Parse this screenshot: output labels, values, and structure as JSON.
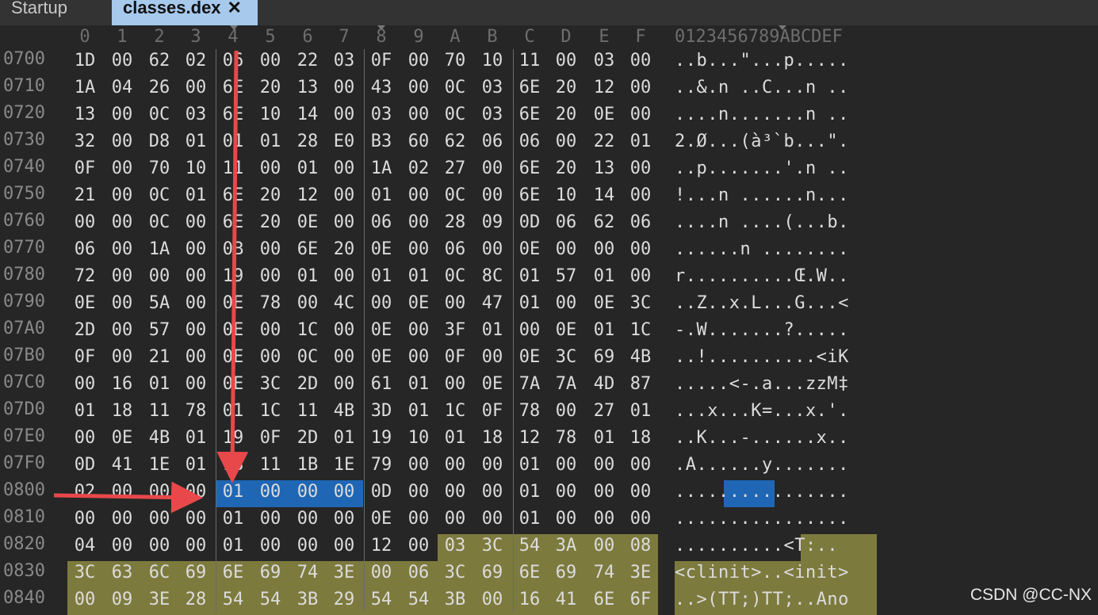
{
  "tabs": [
    {
      "label": "Startup",
      "active": false
    },
    {
      "label": "classes.dex",
      "active": true,
      "close_glyph": "✕"
    }
  ],
  "hex_header": [
    "0",
    "1",
    "2",
    "3",
    "4",
    "5",
    "6",
    "7",
    "8",
    "9",
    "A",
    "B",
    "C",
    "D",
    "E",
    "F"
  ],
  "ascii_header": "0123456789ABCDEF",
  "rows": [
    {
      "addr": "0700",
      "bytes": [
        "1D",
        "00",
        "62",
        "02",
        "06",
        "00",
        "22",
        "03",
        "0F",
        "00",
        "70",
        "10",
        "11",
        "00",
        "03",
        "00"
      ],
      "ascii": "..b...\"...p....."
    },
    {
      "addr": "0710",
      "bytes": [
        "1A",
        "04",
        "26",
        "00",
        "6E",
        "20",
        "13",
        "00",
        "43",
        "00",
        "0C",
        "03",
        "6E",
        "20",
        "12",
        "00"
      ],
      "ascii": "..&.n ..C...n .."
    },
    {
      "addr": "0720",
      "bytes": [
        "13",
        "00",
        "0C",
        "03",
        "6E",
        "10",
        "14",
        "00",
        "03",
        "00",
        "0C",
        "03",
        "6E",
        "20",
        "0E",
        "00"
      ],
      "ascii": "....n.......n .."
    },
    {
      "addr": "0730",
      "bytes": [
        "32",
        "00",
        "D8",
        "01",
        "01",
        "01",
        "28",
        "E0",
        "B3",
        "60",
        "62",
        "06",
        "06",
        "00",
        "22",
        "01"
      ],
      "ascii": "2.Ø...(à³`b...\"."
    },
    {
      "addr": "0740",
      "bytes": [
        "0F",
        "00",
        "70",
        "10",
        "11",
        "00",
        "01",
        "00",
        "1A",
        "02",
        "27",
        "00",
        "6E",
        "20",
        "13",
        "00"
      ],
      "ascii": "..p.......'.n .."
    },
    {
      "addr": "0750",
      "bytes": [
        "21",
        "00",
        "0C",
        "01",
        "6E",
        "20",
        "12",
        "00",
        "01",
        "00",
        "0C",
        "00",
        "6E",
        "10",
        "14",
        "00"
      ],
      "ascii": "!...n ......n..."
    },
    {
      "addr": "0760",
      "bytes": [
        "00",
        "00",
        "0C",
        "00",
        "6E",
        "20",
        "0E",
        "00",
        "06",
        "00",
        "28",
        "09",
        "0D",
        "06",
        "62",
        "06"
      ],
      "ascii": "....n ....(...b."
    },
    {
      "addr": "0770",
      "bytes": [
        "06",
        "00",
        "1A",
        "00",
        "0B",
        "00",
        "6E",
        "20",
        "0E",
        "00",
        "06",
        "00",
        "0E",
        "00",
        "00",
        "00"
      ],
      "ascii": "......n ........"
    },
    {
      "addr": "0780",
      "bytes": [
        "72",
        "00",
        "00",
        "00",
        "19",
        "00",
        "01",
        "00",
        "01",
        "01",
        "0C",
        "8C",
        "01",
        "57",
        "01",
        "00"
      ],
      "ascii": "r..........Œ.W.."
    },
    {
      "addr": "0790",
      "bytes": [
        "0E",
        "00",
        "5A",
        "00",
        "0E",
        "78",
        "00",
        "4C",
        "00",
        "0E",
        "00",
        "47",
        "01",
        "00",
        "0E",
        "3C"
      ],
      "ascii": "..Z..x.L...G...<"
    },
    {
      "addr": "07A0",
      "bytes": [
        "2D",
        "00",
        "57",
        "00",
        "0E",
        "00",
        "1C",
        "00",
        "0E",
        "00",
        "3F",
        "01",
        "00",
        "0E",
        "01",
        "1C"
      ],
      "ascii": "-.W.......?....."
    },
    {
      "addr": "07B0",
      "bytes": [
        "0F",
        "00",
        "21",
        "00",
        "0E",
        "00",
        "0C",
        "00",
        "0E",
        "00",
        "0F",
        "00",
        "0E",
        "3C",
        "69",
        "4B"
      ],
      "ascii": "..!..........<iK"
    },
    {
      "addr": "07C0",
      "bytes": [
        "00",
        "16",
        "01",
        "00",
        "0E",
        "3C",
        "2D",
        "00",
        "61",
        "01",
        "00",
        "0E",
        "7A",
        "7A",
        "4D",
        "87"
      ],
      "ascii": ".....<-.a...zzM‡"
    },
    {
      "addr": "07D0",
      "bytes": [
        "01",
        "18",
        "11",
        "78",
        "01",
        "1C",
        "11",
        "4B",
        "3D",
        "01",
        "1C",
        "0F",
        "78",
        "00",
        "27",
        "01"
      ],
      "ascii": "...x...K=...x.'."
    },
    {
      "addr": "07E0",
      "bytes": [
        "00",
        "0E",
        "4B",
        "01",
        "19",
        "0F",
        "2D",
        "01",
        "19",
        "10",
        "01",
        "18",
        "12",
        "78",
        "01",
        "18"
      ],
      "ascii": "..K...-......x.."
    },
    {
      "addr": "07F0",
      "bytes": [
        "0D",
        "41",
        "1E",
        "01",
        "18",
        "11",
        "1B",
        "1E",
        "79",
        "00",
        "00",
        "00",
        "01",
        "00",
        "00",
        "00"
      ],
      "ascii": ".A......y......."
    },
    {
      "addr": "0800",
      "bytes": [
        "02",
        "00",
        "00",
        "00",
        "01",
        "00",
        "00",
        "00",
        "0D",
        "00",
        "00",
        "00",
        "01",
        "00",
        "00",
        "00"
      ],
      "ascii": "................"
    },
    {
      "addr": "0810",
      "bytes": [
        "00",
        "00",
        "00",
        "00",
        "01",
        "00",
        "00",
        "00",
        "0E",
        "00",
        "00",
        "00",
        "01",
        "00",
        "00",
        "00"
      ],
      "ascii": "................"
    },
    {
      "addr": "0820",
      "bytes": [
        "04",
        "00",
        "00",
        "00",
        "01",
        "00",
        "00",
        "00",
        "12",
        "00",
        "03",
        "3C",
        "54",
        "3A",
        "00",
        "08"
      ],
      "ascii": "..........<T:.."
    },
    {
      "addr": "0830",
      "bytes": [
        "3C",
        "63",
        "6C",
        "69",
        "6E",
        "69",
        "74",
        "3E",
        "00",
        "06",
        "3C",
        "69",
        "6E",
        "69",
        "74",
        "3E"
      ],
      "ascii": "<clinit>..<init>"
    },
    {
      "addr": "0840",
      "bytes": [
        "00",
        "09",
        "3E",
        "28",
        "54",
        "54",
        "3B",
        "29",
        "54",
        "54",
        "3B",
        "00",
        "16",
        "41",
        "6E",
        "6F"
      ],
      "ascii": "..>(TT;)TT;..Ano"
    }
  ],
  "watermark": "CSDN @CC-NX",
  "colors": {
    "background": "#262626",
    "selection": "#1f67b5",
    "string_highlight": "#7d7a3e",
    "arrow": "#e8484a"
  }
}
